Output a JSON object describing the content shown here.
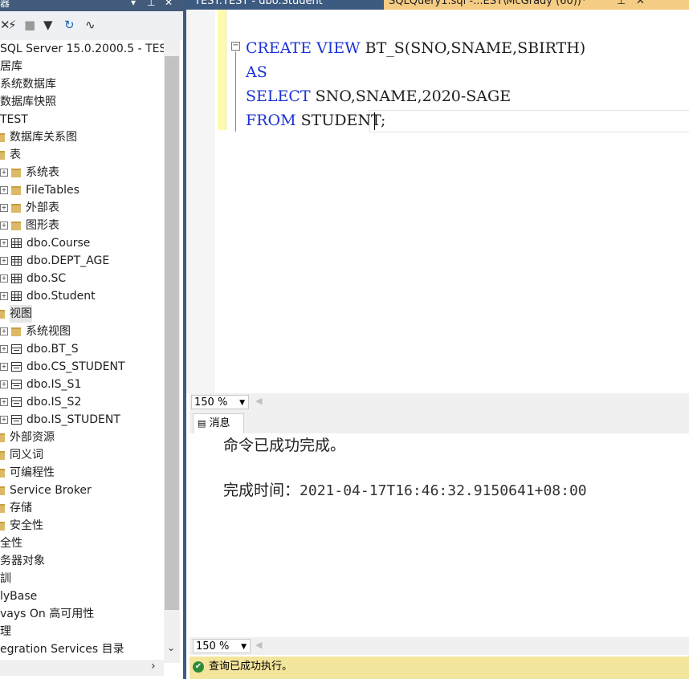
{
  "object_explorer": {
    "title": "器",
    "toolbar_icons": [
      "connect-icon",
      "disconnect-icon",
      "stop-icon",
      "filter-icon",
      "refresh-icon",
      "activity-icon"
    ],
    "tree": [
      {
        "label": "SQL Server 15.0.2000.5 - TES",
        "kind": "server"
      },
      {
        "label": "居库",
        "kind": "text"
      },
      {
        "label": "系统数据库",
        "kind": "text"
      },
      {
        "label": "数据库快照",
        "kind": "text"
      },
      {
        "label": "TEST",
        "kind": "text"
      },
      {
        "label": "数据库关系图",
        "kind": "folder"
      },
      {
        "label": "表",
        "kind": "folder"
      },
      {
        "label": "系统表",
        "kind": "folder"
      },
      {
        "label": "FileTables",
        "kind": "folder"
      },
      {
        "label": "外部表",
        "kind": "folder"
      },
      {
        "label": "图形表",
        "kind": "folder"
      },
      {
        "label": "dbo.Course",
        "kind": "table"
      },
      {
        "label": "dbo.DEPT_AGE",
        "kind": "table"
      },
      {
        "label": "dbo.SC",
        "kind": "table"
      },
      {
        "label": "dbo.Student",
        "kind": "table"
      },
      {
        "label": "视图",
        "kind": "folder"
      },
      {
        "label": "系统视图",
        "kind": "folder"
      },
      {
        "label": "dbo.BT_S",
        "kind": "view"
      },
      {
        "label": "dbo.CS_STUDENT",
        "kind": "view"
      },
      {
        "label": "dbo.IS_S1",
        "kind": "view"
      },
      {
        "label": "dbo.IS_S2",
        "kind": "view"
      },
      {
        "label": "dbo.IS_STUDENT",
        "kind": "view"
      },
      {
        "label": "外部资源",
        "kind": "folder"
      },
      {
        "label": "同义词",
        "kind": "folder"
      },
      {
        "label": "可编程性",
        "kind": "folder"
      },
      {
        "label": "Service Broker",
        "kind": "folder"
      },
      {
        "label": "存储",
        "kind": "folder"
      },
      {
        "label": "安全性",
        "kind": "folder"
      },
      {
        "label": "全性",
        "kind": "text"
      },
      {
        "label": "务器对象",
        "kind": "text"
      },
      {
        "label": "訓",
        "kind": "text"
      },
      {
        "label": "lyBase",
        "kind": "text"
      },
      {
        "label": "vays On 高可用性",
        "kind": "text"
      },
      {
        "label": "理",
        "kind": "text"
      },
      {
        "label": "egration Services 目录",
        "kind": "text"
      }
    ]
  },
  "tabs": {
    "tab1": "TEST.TEST - dbo.Student",
    "tab2": "SQLQuery1.sql -...EST\\McGrady (60))*"
  },
  "editor": {
    "line1_kw1": "CREATE",
    "line1_kw2": "VIEW",
    "line1_rest": "BT_S(SNO,SNAME,SBIRTH)",
    "line2_kw": "AS",
    "line3_kw": "SELECT",
    "line3_rest": "SNO,SNAME,2020-SAGE",
    "line4_kw": "FROM",
    "line4_rest": "STUDENT;",
    "zoom": "150 %"
  },
  "results": {
    "tab_label": "消息",
    "message1": "命令已成功完成。",
    "completion_label": "完成时间：",
    "completion_time": "2021-04-17T16:46:32.9150641+08:00",
    "zoom": "150 %"
  },
  "status": {
    "text": "查询已成功执行。"
  },
  "colors": {
    "keyword": "#1a31d6",
    "title_bar": "#3d5a80",
    "status_bar": "#f4e59c"
  }
}
